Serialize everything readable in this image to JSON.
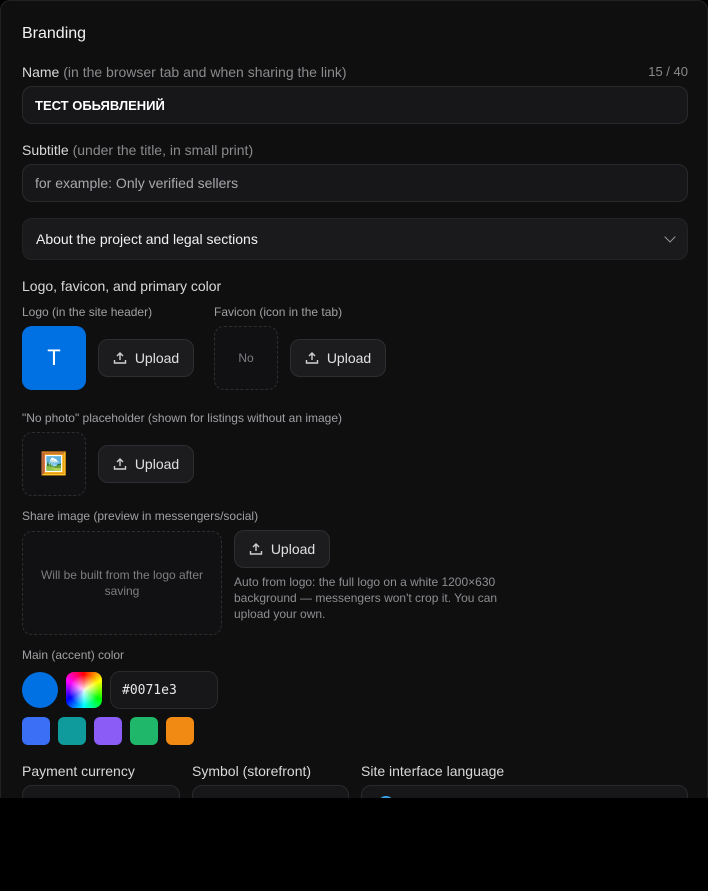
{
  "branding": {
    "title": "Branding",
    "name": {
      "label": "Name",
      "hint": "(in the browser tab and when sharing the link)",
      "counter": "15 / 40",
      "value": "ТЕСТ ОБЬЯВЛЕНИЙ"
    },
    "subtitle": {
      "label": "Subtitle",
      "hint": "(under the title, in small print)",
      "placeholder": "for example: Only verified sellers"
    },
    "about_accordion": {
      "label": "About the project and legal sections"
    },
    "logo_section": {
      "heading": "Logo, favicon, and primary color",
      "logo_label": "Logo (in the site header)",
      "logo_letter": "T",
      "favicon_label": "Favicon (icon in the tab)",
      "favicon_empty": "No",
      "upload_label": "Upload",
      "placeholder_label": "\"No photo\" placeholder (shown for listings without an image)",
      "placeholder_icon": "🖼️",
      "share_label": "Share image (preview in messengers/social)",
      "share_empty": "Will be built from the logo after saving",
      "share_note": "Auto from logo: the full logo on a white 1200×630 background — messengers won't crop it. You can upload your own."
    },
    "accent": {
      "label": "Main (accent) color",
      "value": "#0071e3",
      "swatches": [
        "#3b6ff5",
        "#0f9b9b",
        "#8b5cf6",
        "#1fb86a",
        "#f08a12"
      ]
    },
    "bottom": {
      "currency_label": "Payment currency",
      "symbol_label": "Symbol (storefront)",
      "language_label": "Site interface language"
    }
  }
}
